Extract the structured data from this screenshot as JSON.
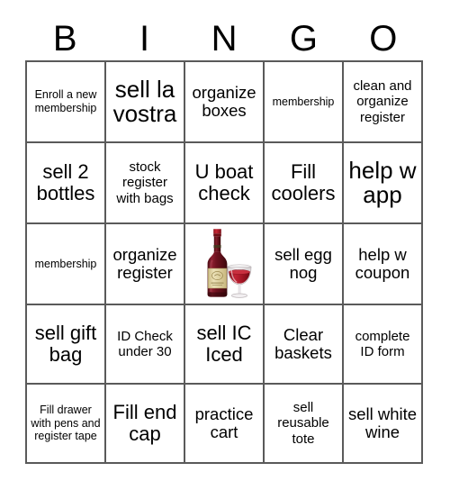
{
  "header": {
    "letters": [
      "B",
      "I",
      "N",
      "G",
      "O"
    ]
  },
  "grid": {
    "rows": [
      [
        {
          "text": "Enroll a new membership",
          "size": "xs"
        },
        {
          "text": "sell la vostra",
          "size": "xl"
        },
        {
          "text": "organize boxes",
          "size": "md"
        },
        {
          "text": "membership",
          "size": "xs"
        },
        {
          "text": "clean and organize register",
          "size": "sm"
        }
      ],
      [
        {
          "text": "sell 2 bottles",
          "size": "lg"
        },
        {
          "text": "stock register with bags",
          "size": "sm"
        },
        {
          "text": "U boat check",
          "size": "lg"
        },
        {
          "text": "Fill coolers",
          "size": "lg"
        },
        {
          "text": "help w app",
          "size": "xl"
        }
      ],
      [
        {
          "text": "membership",
          "size": "xs"
        },
        {
          "text": "organize register",
          "size": "md"
        },
        {
          "text": "",
          "size": "md",
          "icon": "wine-bottle-and-glass-image"
        },
        {
          "text": "sell egg nog",
          "size": "md"
        },
        {
          "text": "help w coupon",
          "size": "md"
        }
      ],
      [
        {
          "text": "sell gift bag",
          "size": "lg"
        },
        {
          "text": "ID Check under 30",
          "size": "sm"
        },
        {
          "text": "sell IC Iced",
          "size": "lg"
        },
        {
          "text": "Clear baskets",
          "size": "md"
        },
        {
          "text": "complete ID form",
          "size": "sm"
        }
      ],
      [
        {
          "text": "Fill drawer with pens and register tape",
          "size": "xs"
        },
        {
          "text": "Fill end cap",
          "size": "lg"
        },
        {
          "text": "practice cart",
          "size": "md"
        },
        {
          "text": "sell reusable tote",
          "size": "sm"
        },
        {
          "text": "sell white wine",
          "size": "md"
        }
      ]
    ]
  },
  "colors": {
    "border": "#5a5a5a",
    "text": "#000000",
    "background": "#ffffff",
    "wine_bottle_glass": "#6d1220",
    "wine_liquid": "#a81c2a",
    "bottle_cap": "#b51c28",
    "label_paper": "#e4d8a8"
  }
}
